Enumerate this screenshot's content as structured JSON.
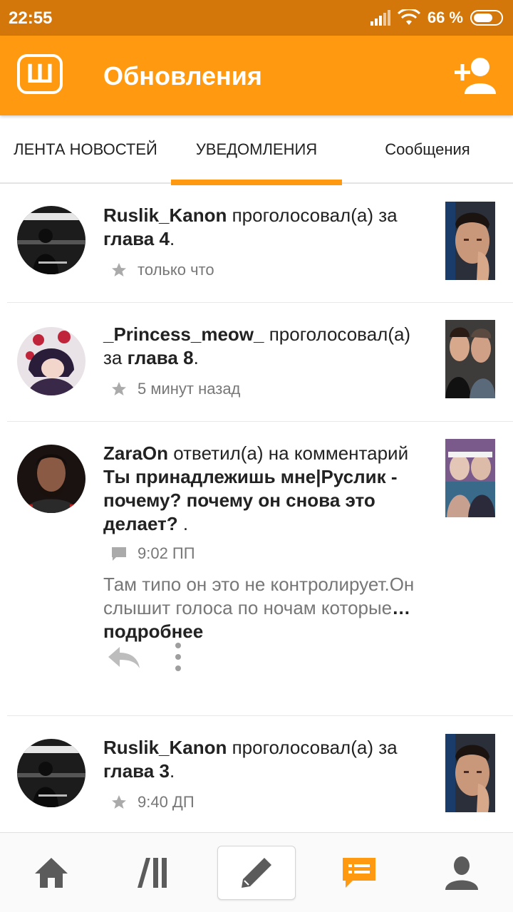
{
  "status_bar": {
    "time": "22:55",
    "battery_percent": "66 %",
    "battery_level": 0.66
  },
  "app_bar": {
    "logo_letter": "Ш",
    "title": "Обновления",
    "add_user_icon": "add-user-icon"
  },
  "tabs": [
    {
      "label": "ЛЕНТА НОВОСТЕЙ",
      "active": false
    },
    {
      "label": "УВЕДОМЛЕНИЯ",
      "active": true
    },
    {
      "label": "Сообщения",
      "active": false
    }
  ],
  "colors": {
    "accent": "#ff9a10",
    "status_bar": "#d4770a",
    "icon_gray": "#5b5b5b",
    "meta_gray": "#777777"
  },
  "notifications": [
    {
      "user": "Ruslik_Kanon",
      "action": " проголосовал(а) за ",
      "target": "глава 4",
      "suffix": ".",
      "meta_icon": "star-icon",
      "time": "только что"
    },
    {
      "user": "_Princess_meow_",
      "action": " проголосовал(а) за ",
      "target": "глава 8",
      "suffix": ".",
      "meta_icon": "star-icon",
      "time": "5 минут назад"
    },
    {
      "user": "ZaraOn",
      "action": " ответил(а) на комментарий ",
      "target": "Ты принадлежишь мне|Руслик - почему? почему он снова это делает?",
      "suffix": " .",
      "meta_icon": "comment-icon",
      "time": "9:02 ПП",
      "excerpt": "Там типо он это не контролирует.Он слышит голоса по ночам которые",
      "more_label": "… подробнее"
    },
    {
      "user": "Ruslik_Kanon",
      "action": " проголосовал(а) за ",
      "target": "глава 3",
      "suffix": ".",
      "meta_icon": "star-icon",
      "time": "9:40 ДП"
    }
  ],
  "bottom_nav": [
    "home-icon",
    "library-icon",
    "write-icon",
    "notifications-icon",
    "profile-icon"
  ]
}
